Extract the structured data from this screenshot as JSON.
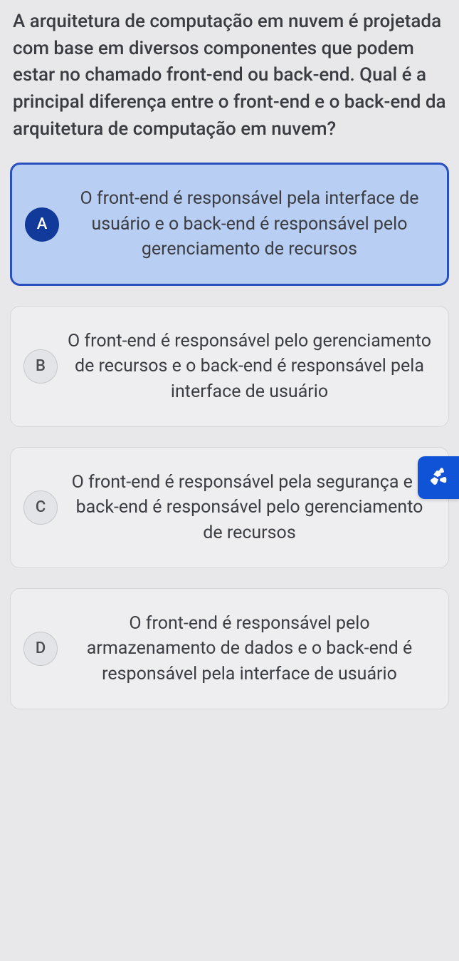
{
  "question": {
    "text": "A arquitetura de computação em nuvem é projetada com base em diversos componentes que podem estar no chamado front-end ou back-end. Qual é a principal diferença entre o front-end e o back-end da arquitetura de computação em nuvem?"
  },
  "options": [
    {
      "letter": "A",
      "text": "O front-end é responsável pela interface de usuário e o back-end é responsável pelo gerenciamento de recursos",
      "selected": true
    },
    {
      "letter": "B",
      "text": "O front-end é responsável pelo gerenciamento de recursos e o back-end é responsável pela interface de usuário",
      "selected": false
    },
    {
      "letter": "C",
      "text": "O front-end é responsável pela segurança e o back-end é responsável pelo gerenciamento de recursos",
      "selected": false
    },
    {
      "letter": "D",
      "text": "O front-end é responsável pelo armazenamento de dados e o back-end é responsável pela interface de usuário",
      "selected": false
    }
  ],
  "accessibility": {
    "name": "sign-language-icon"
  }
}
